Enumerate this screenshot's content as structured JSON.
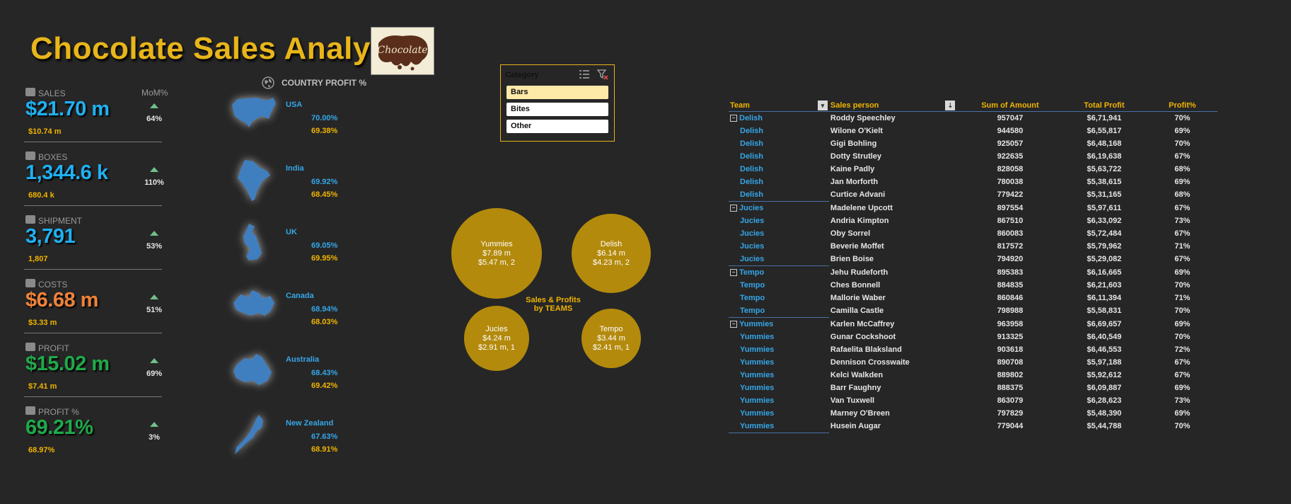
{
  "title": "Chocolate Sales Analysis",
  "logo_text": "Chocolate",
  "kpis": {
    "mom_header": "MoM%",
    "items": [
      {
        "label": "SALES",
        "value": "$21.70 m",
        "prev": "$10.74 m",
        "mom": "64%",
        "color": "#1fb0f2",
        "icon": "cart-icon"
      },
      {
        "label": "BOXES",
        "value": "1,344.6 k",
        "prev": "680.4 k",
        "mom": "110%",
        "color": "#1fb0f2",
        "icon": "box-icon"
      },
      {
        "label": "SHIPMENT",
        "value": "3,791",
        "prev": "1,807",
        "mom": "53%",
        "color": "#1fb0f2",
        "icon": "ship-icon"
      },
      {
        "label": "COSTS",
        "value": "$6.68 m",
        "prev": "$3.33 m",
        "mom": "51%",
        "color": "#f0823a",
        "icon": "coins-icon"
      },
      {
        "label": "PROFIT",
        "value": "$15.02 m",
        "prev": "$7.41 m",
        "mom": "69%",
        "color": "#1faa4a",
        "icon": "piggy-bank-icon"
      },
      {
        "label": "PROFIT %",
        "value": "69.21%",
        "prev": "68.97%",
        "mom": "3%",
        "color": "#1faa4a",
        "icon": "piggy-bank-icon"
      }
    ]
  },
  "country_profit": {
    "header": "COUNTRY PROFIT %",
    "countries": [
      {
        "name": "USA",
        "current": "70.00%",
        "previous": "69.38%"
      },
      {
        "name": "India",
        "current": "69.92%",
        "previous": "68.45%"
      },
      {
        "name": "UK",
        "current": "69.05%",
        "previous": "69.95%"
      },
      {
        "name": "Canada",
        "current": "68.94%",
        "previous": "68.03%"
      },
      {
        "name": "Australia",
        "current": "68.43%",
        "previous": "69.42%"
      },
      {
        "name": "New Zealand",
        "current": "67.63%",
        "previous": "68.91%"
      }
    ]
  },
  "slicer": {
    "header": "Category",
    "options": [
      {
        "label": "Bars",
        "selected": true
      },
      {
        "label": "Bites",
        "selected": false
      },
      {
        "label": "Other",
        "selected": false
      }
    ]
  },
  "bubble_chart": {
    "caption_line1": "Sales & Profits",
    "caption_line2": "by TEAMS",
    "bubbles": [
      {
        "team": "Yummies",
        "sales": "$7.89 m",
        "detail": "$5.47 m, 2"
      },
      {
        "team": "Delish",
        "sales": "$6.14 m",
        "detail": "$4.23 m, 2"
      },
      {
        "team": "Jucies",
        "sales": "$4.24 m",
        "detail": "$2.91 m, 1"
      },
      {
        "team": "Tempo",
        "sales": "$3.44 m",
        "detail": "$2.41 m, 1"
      }
    ]
  },
  "pivot": {
    "headers": {
      "team": "Team",
      "person": "Sales person",
      "amount": "Sum of Amount",
      "profit": "Total Profit",
      "pct": "Profit%"
    },
    "rows": [
      {
        "team": "Delish",
        "person": "Roddy Speechley",
        "amount": "957047",
        "profit": "$6,71,941",
        "pct": "70%",
        "first": true
      },
      {
        "team": "Delish",
        "person": "Wilone O'Kielt",
        "amount": "944580",
        "profit": "$6,55,817",
        "pct": "69%"
      },
      {
        "team": "Delish",
        "person": "Gigi Bohling",
        "amount": "925057",
        "profit": "$6,48,168",
        "pct": "70%"
      },
      {
        "team": "Delish",
        "person": "Dotty Strutley",
        "amount": "922635",
        "profit": "$6,19,638",
        "pct": "67%"
      },
      {
        "team": "Delish",
        "person": "Kaine Padly",
        "amount": "828058",
        "profit": "$5,63,722",
        "pct": "68%"
      },
      {
        "team": "Delish",
        "person": "Jan Morforth",
        "amount": "780038",
        "profit": "$5,38,615",
        "pct": "69%"
      },
      {
        "team": "Delish",
        "person": "Curtice Advani",
        "amount": "779422",
        "profit": "$5,31,165",
        "pct": "68%"
      },
      {
        "team": "Jucies",
        "person": "Madelene Upcott",
        "amount": "897554",
        "profit": "$5,97,611",
        "pct": "67%",
        "first": true
      },
      {
        "team": "Jucies",
        "person": "Andria Kimpton",
        "amount": "867510",
        "profit": "$6,33,092",
        "pct": "73%"
      },
      {
        "team": "Jucies",
        "person": "Oby Sorrel",
        "amount": "860083",
        "profit": "$5,72,484",
        "pct": "67%"
      },
      {
        "team": "Jucies",
        "person": "Beverie Moffet",
        "amount": "817572",
        "profit": "$5,79,962",
        "pct": "71%"
      },
      {
        "team": "Jucies",
        "person": "Brien Boise",
        "amount": "794920",
        "profit": "$5,29,082",
        "pct": "67%"
      },
      {
        "team": "Tempo",
        "person": "Jehu Rudeforth",
        "amount": "895383",
        "profit": "$6,16,665",
        "pct": "69%",
        "first": true
      },
      {
        "team": "Tempo",
        "person": "Ches Bonnell",
        "amount": "884835",
        "profit": "$6,21,603",
        "pct": "70%"
      },
      {
        "team": "Tempo",
        "person": "Mallorie Waber",
        "amount": "860846",
        "profit": "$6,11,394",
        "pct": "71%"
      },
      {
        "team": "Tempo",
        "person": "Camilla Castle",
        "amount": "798988",
        "profit": "$5,58,831",
        "pct": "70%"
      },
      {
        "team": "Yummies",
        "person": "Karlen McCaffrey",
        "amount": "963958",
        "profit": "$6,69,657",
        "pct": "69%",
        "first": true
      },
      {
        "team": "Yummies",
        "person": "Gunar Cockshoot",
        "amount": "913325",
        "profit": "$6,40,549",
        "pct": "70%"
      },
      {
        "team": "Yummies",
        "person": "Rafaelita Blaksland",
        "amount": "903618",
        "profit": "$6,46,553",
        "pct": "72%"
      },
      {
        "team": "Yummies",
        "person": "Dennison Crosswaite",
        "amount": "890708",
        "profit": "$5,97,188",
        "pct": "67%"
      },
      {
        "team": "Yummies",
        "person": "Kelci Walkden",
        "amount": "889802",
        "profit": "$5,92,612",
        "pct": "67%"
      },
      {
        "team": "Yummies",
        "person": "Barr Faughny",
        "amount": "888375",
        "profit": "$6,09,887",
        "pct": "69%"
      },
      {
        "team": "Yummies",
        "person": "Van Tuxwell",
        "amount": "863079",
        "profit": "$6,28,623",
        "pct": "73%"
      },
      {
        "team": "Yummies",
        "person": "Marney O'Breen",
        "amount": "797829",
        "profit": "$5,48,390",
        "pct": "69%"
      },
      {
        "team": "Yummies",
        "person": "Husein Augar",
        "amount": "779044",
        "profit": "$5,44,788",
        "pct": "70%"
      }
    ]
  }
}
